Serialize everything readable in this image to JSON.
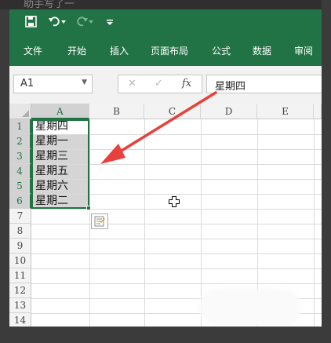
{
  "caption": "助手写了一",
  "quick_access": {
    "save_icon": "save-icon",
    "undo_icon": "undo-icon",
    "redo_icon": "redo-icon",
    "customize_icon": "customize-qat-icon"
  },
  "ribbon_tabs": [
    "文件",
    "开始",
    "插入",
    "页面布局",
    "公式",
    "数据",
    "审阅"
  ],
  "name_box": {
    "value": "A1"
  },
  "formula_bar": {
    "cancel": "✕",
    "enter": "✓",
    "fx_label": "fx",
    "value": "星期四"
  },
  "columns": [
    "A",
    "B",
    "C",
    "D",
    "E"
  ],
  "rows": [
    "1",
    "2",
    "3",
    "4",
    "5",
    "6",
    "7",
    "8",
    "9",
    "10",
    "11",
    "12",
    "13",
    "14"
  ],
  "cells": [
    "星期四",
    "星期一",
    "星期三",
    "星期五",
    "星期六",
    "星期二"
  ],
  "colors": {
    "ribbon": "#217346",
    "selection_border": "#217346",
    "annotation_arrow": "#e8403a"
  }
}
